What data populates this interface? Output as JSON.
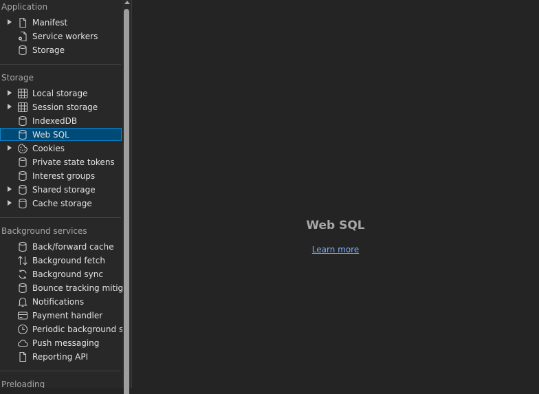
{
  "sidebar": {
    "sections": [
      {
        "title": "Application"
      },
      {
        "title": "Storage"
      },
      {
        "title": "Background services"
      },
      {
        "title": "Preloading"
      }
    ],
    "application_items": [
      {
        "label": "Manifest",
        "icon": "file-icon",
        "expandable": true
      },
      {
        "label": "Service workers",
        "icon": "gear-file-icon",
        "expandable": false
      },
      {
        "label": "Storage",
        "icon": "database-icon",
        "expandable": false
      }
    ],
    "storage_items": [
      {
        "label": "Local storage",
        "icon": "table-icon",
        "expandable": true
      },
      {
        "label": "Session storage",
        "icon": "table-icon",
        "expandable": true
      },
      {
        "label": "IndexedDB",
        "icon": "database-icon",
        "expandable": false
      },
      {
        "label": "Web SQL",
        "icon": "database-icon",
        "expandable": false,
        "selected": true
      },
      {
        "label": "Cookies",
        "icon": "cookie-icon",
        "expandable": true
      },
      {
        "label": "Private state tokens",
        "icon": "database-icon",
        "expandable": false
      },
      {
        "label": "Interest groups",
        "icon": "database-icon",
        "expandable": false
      },
      {
        "label": "Shared storage",
        "icon": "database-icon",
        "expandable": true
      },
      {
        "label": "Cache storage",
        "icon": "database-icon",
        "expandable": true
      }
    ],
    "background_items": [
      {
        "label": "Back/forward cache",
        "icon": "database-icon"
      },
      {
        "label": "Background fetch",
        "icon": "up-down-arrows-icon"
      },
      {
        "label": "Background sync",
        "icon": "sync-icon"
      },
      {
        "label": "Bounce tracking mitigations",
        "icon": "database-icon"
      },
      {
        "label": "Notifications",
        "icon": "bell-icon"
      },
      {
        "label": "Payment handler",
        "icon": "credit-card-icon"
      },
      {
        "label": "Periodic background sync",
        "icon": "clock-icon"
      },
      {
        "label": "Push messaging",
        "icon": "cloud-icon"
      },
      {
        "label": "Reporting API",
        "icon": "file-icon"
      }
    ]
  },
  "main": {
    "heading": "Web SQL",
    "link": "Learn more"
  },
  "colors": {
    "selected_bg": "#004a77",
    "link": "#7cacf8",
    "heading": "#a8a8a8"
  }
}
